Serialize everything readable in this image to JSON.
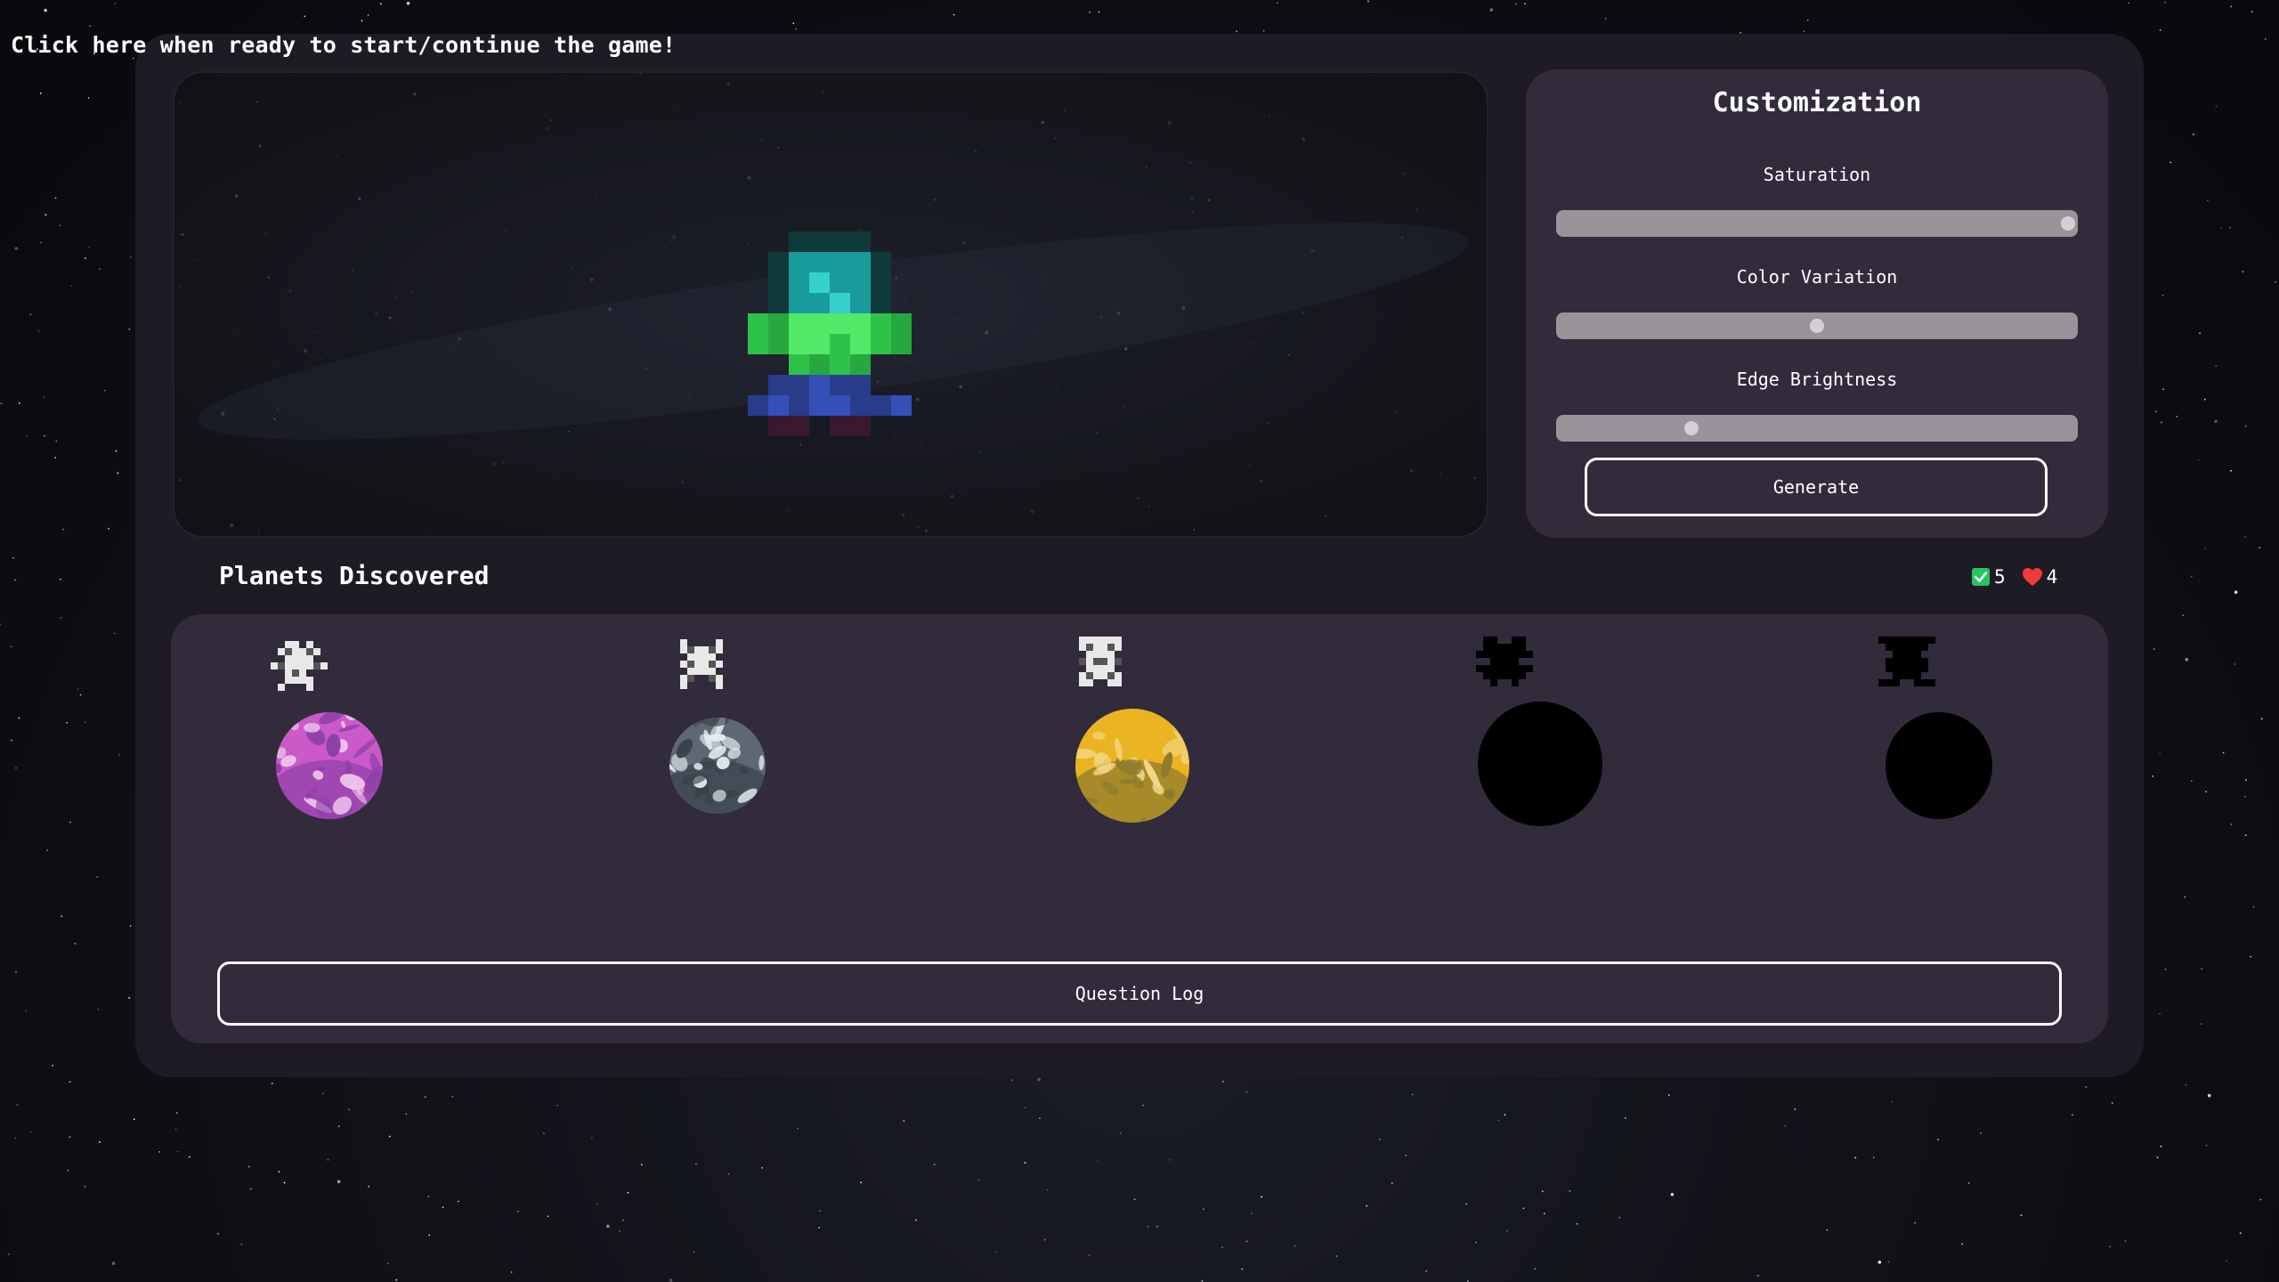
{
  "prompt": {
    "start_text": "Click here when ready to start/continue the game!"
  },
  "customization": {
    "title": "Customization",
    "sliders": [
      {
        "label": "Saturation",
        "value": 1.0
      },
      {
        "label": "Color Variation",
        "value": 0.5
      },
      {
        "label": "Edge Brightness",
        "value": 0.25
      }
    ],
    "generate_label": "Generate"
  },
  "planets": {
    "title": "Planets Discovered",
    "correct_count": "5",
    "lives_count": "4",
    "items": [
      {
        "discovered": true,
        "planet_color": "#c95ac8",
        "planet_shade": "#8e3fa8",
        "planet_light": "#f0c6ee"
      },
      {
        "discovered": true,
        "planet_color": "#5d6873",
        "planet_shade": "#39424b",
        "planet_light": "#e6ecef"
      },
      {
        "discovered": true,
        "planet_color": "#eab321",
        "planet_shade": "#8a7a2c",
        "planet_light": "#f4d88a"
      },
      {
        "discovered": false,
        "planet_color": "#000000",
        "planet_shade": "#000000",
        "planet_light": "#000000"
      },
      {
        "discovered": false,
        "planet_color": "#000000",
        "planet_shade": "#000000",
        "planet_light": "#000000"
      }
    ],
    "question_log_label": "Question Log"
  },
  "colors": {
    "check_green": "#22c55e",
    "heart_red": "#ef3b3b",
    "panel_bg": "#322b3c"
  }
}
